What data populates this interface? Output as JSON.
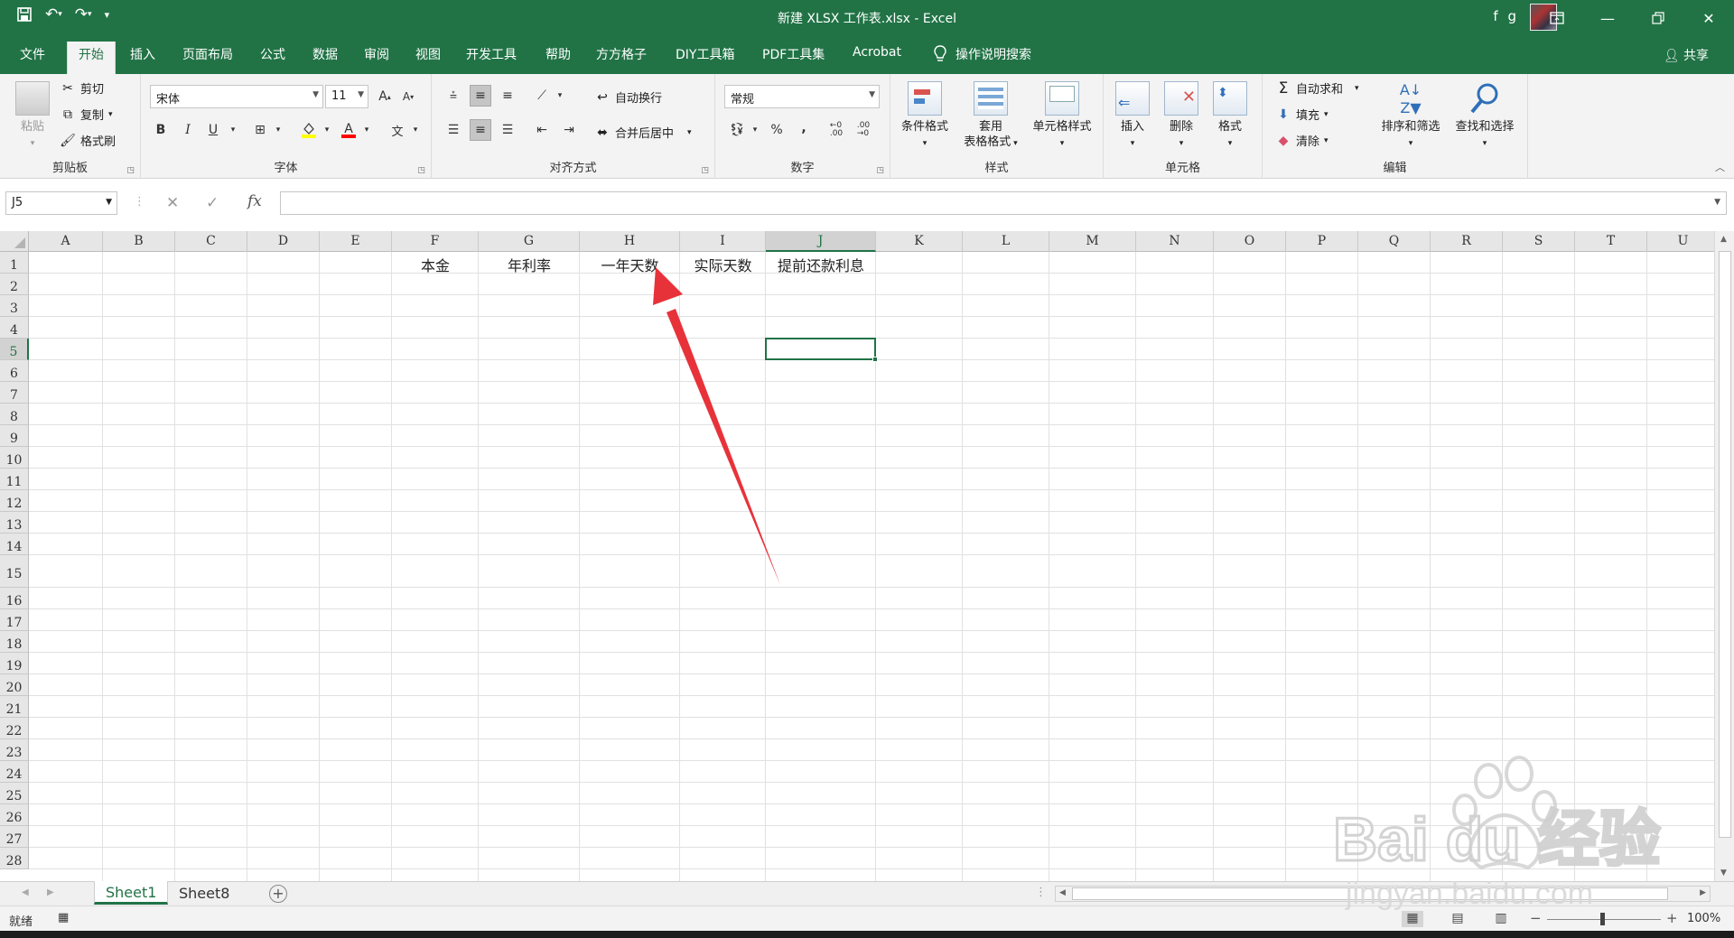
{
  "window": {
    "title": "新建 XLSX 工作表.xlsx  -  Excel",
    "user": "f g"
  },
  "tabs": [
    "文件",
    "开始",
    "插入",
    "页面布局",
    "公式",
    "数据",
    "审阅",
    "视图",
    "开发工具",
    "帮助",
    "方方格子",
    "DIY工具箱",
    "PDF工具集",
    "Acrobat"
  ],
  "active_tab": "开始",
  "tell_me": "操作说明搜索",
  "share": "共享",
  "ribbon": {
    "clipboard": {
      "label": "剪贴板",
      "paste": "粘贴",
      "cut": "剪切",
      "copy": "复制",
      "format_painter": "格式刷"
    },
    "font": {
      "label": "字体",
      "name": "宋体",
      "size": "11",
      "bold": "B",
      "italic": "I",
      "underline": "U"
    },
    "alignment": {
      "label": "对齐方式",
      "wrap": "自动换行",
      "merge": "合并后居中"
    },
    "number": {
      "label": "数字",
      "format": "常规",
      "percent": "%",
      "comma": ","
    },
    "styles": {
      "label": "样式",
      "conditional": "条件格式",
      "table_line1": "套用",
      "table_line2": "表格格式",
      "cell_styles": "单元格样式"
    },
    "cells": {
      "label": "单元格",
      "insert": "插入",
      "delete": "删除",
      "format": "格式"
    },
    "editing": {
      "label": "编辑",
      "autosum": "自动求和",
      "fill": "填充",
      "clear": "清除",
      "sort": "排序和筛选",
      "find": "查找和选择"
    }
  },
  "name_box": "J5",
  "formula": "",
  "sheet": {
    "columns": [
      "A",
      "B",
      "C",
      "D",
      "E",
      "F",
      "G",
      "H",
      "I",
      "J",
      "K",
      "L",
      "M",
      "N",
      "O",
      "P",
      "Q",
      "R",
      "S",
      "T",
      "U"
    ],
    "rows": [
      "1",
      "2",
      "3",
      "4",
      "5",
      "6",
      "7",
      "8",
      "9",
      "10",
      "11",
      "12",
      "13",
      "14",
      "15",
      "16",
      "17",
      "18",
      "19",
      "20",
      "21",
      "22",
      "23",
      "24",
      "25",
      "26",
      "27",
      "28"
    ],
    "selected_column": "J",
    "selected_row": "5",
    "cells": [
      {
        "ref": "F1",
        "value": "本金"
      },
      {
        "ref": "G1",
        "value": "年利率"
      },
      {
        "ref": "H1",
        "value": "一年天数"
      },
      {
        "ref": "I1",
        "value": "实际天数"
      },
      {
        "ref": "J1",
        "value": "提前还款利息"
      }
    ],
    "annotation_color": "#e8323a"
  },
  "sheet_tabs": [
    "Sheet1",
    "Sheet8"
  ],
  "active_sheet": "Sheet1",
  "status": {
    "ready": "就绪",
    "zoom": "100%",
    "zoom_level": 100
  },
  "watermark": {
    "logo": "Bai du 经验",
    "url": "jingyan.baidu.com"
  },
  "colors": {
    "accent": "#217346",
    "ribbon_bg": "#f3f3f3"
  }
}
